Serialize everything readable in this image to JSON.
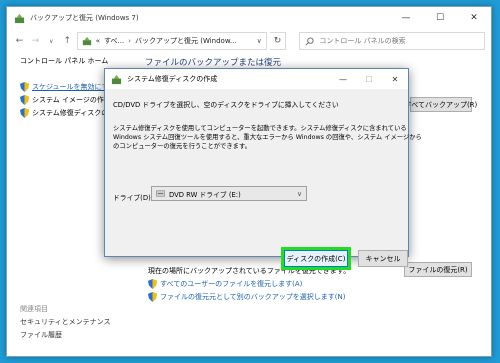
{
  "main_window": {
    "title": "バックアップと復元 (Windows 7)",
    "controls": [
      "—",
      "☐",
      "✕"
    ]
  },
  "address_bar": {
    "back": "←",
    "forward": "→",
    "dropdown": "∨",
    "up": "↑",
    "breadcrumb_prefix": "«",
    "crumb_1": "すべ...",
    "crumb_2": "バックアップと復元 (Window...",
    "chevron": "∨",
    "refresh": "↻"
  },
  "search": {
    "placeholder": "コントロール パネルの検索"
  },
  "sidebar": {
    "home": "コントロール パネル ホーム",
    "links": [
      {
        "label": "スケジュールを無効にする"
      },
      {
        "label": "システム イメージの作成"
      },
      {
        "label": "システム修復ディスクの作成"
      }
    ],
    "see_also": "関連項目",
    "bottom_items": [
      "セキュリティとメンテナンス",
      "ファイル履歴"
    ]
  },
  "main": {
    "heading": "ファイルのバックアップまたは復元",
    "setup_button": "すべてバックアップ(R)",
    "restore_text": "現在の場所にバックアップされているファイルを復元できます。",
    "restore_button": "ファイルの復元(R)",
    "restore_links": [
      "すべてのユーザーのファイルを復元します(A)",
      "ファイルの復元元として別のバックアップを選択します(N)"
    ]
  },
  "dialog": {
    "title": "システム修復ディスクの作成",
    "controls": [
      "—",
      "☐",
      "✕"
    ],
    "instruction": "CD/DVD ドライブを選択し、空のディスクをドライブに挿入してください",
    "desc_lines": [
      "システム修復ディスクを使用してコンピューターを起動できます。システム修復ディスクに含まれている",
      "Windows システム回復ツールを使用すると、重大なエラーから Windows の回復や、システム イメージから",
      "のコンピューターの復元を行うことができます。"
    ],
    "drive_label": "ドライブ(D):",
    "drive_value": "DVD RW ドライブ (E:)",
    "create_button": "ディスクの作成(C)",
    "cancel_button": "キャンセル"
  },
  "colors": {
    "desktop": "#1f9bd6",
    "link": "#1a5fb4",
    "heading": "#1e3c78",
    "highlight": "#22dd22"
  }
}
